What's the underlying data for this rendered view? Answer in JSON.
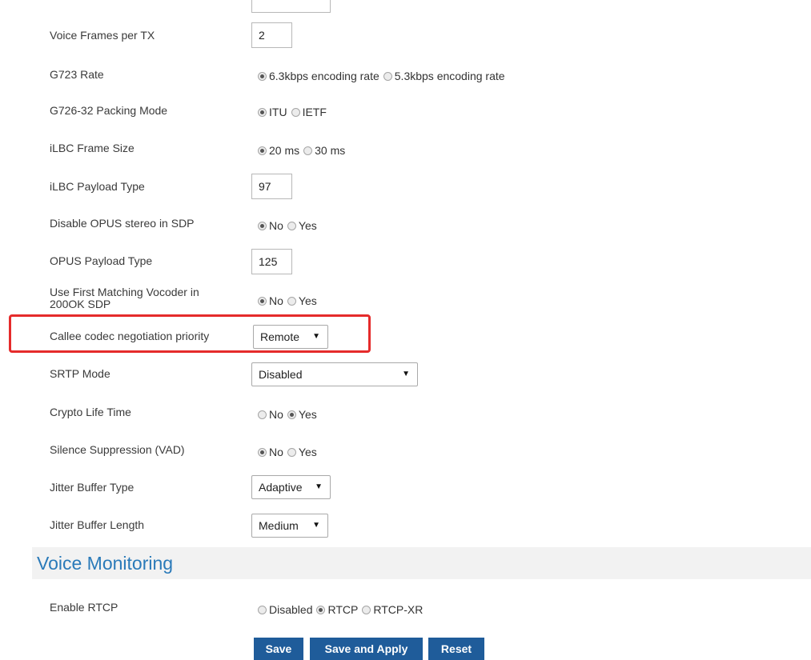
{
  "top_input": {
    "value": ""
  },
  "rows": {
    "voice_frames": {
      "label": "Voice Frames per TX",
      "value": "2"
    },
    "g723_rate": {
      "label": "G723 Rate",
      "options": [
        "6.3kbps encoding rate",
        "5.3kbps encoding rate"
      ],
      "selected": "6.3kbps encoding rate"
    },
    "g726_packing": {
      "label": "G726-32 Packing Mode",
      "options": [
        "ITU",
        "IETF"
      ],
      "selected": "ITU"
    },
    "ilbc_frame": {
      "label": "iLBC Frame Size",
      "options": [
        "20 ms",
        "30 ms"
      ],
      "selected": "20 ms"
    },
    "ilbc_payload": {
      "label": "iLBC Payload Type",
      "value": "97"
    },
    "disable_opus_stereo": {
      "label": "Disable OPUS stereo in SDP",
      "options": [
        "No",
        "Yes"
      ],
      "selected": "No"
    },
    "opus_payload": {
      "label": "OPUS Payload Type",
      "value": "125"
    },
    "first_matching_vocoder": {
      "label_line1": "Use First Matching Vocoder in",
      "label_line2": "200OK SDP",
      "options": [
        "No",
        "Yes"
      ],
      "selected": "No"
    },
    "callee_priority": {
      "label": "Callee codec negotiation priority",
      "value": "Remote"
    },
    "srtp_mode": {
      "label": "SRTP Mode",
      "value": "Disabled"
    },
    "crypto_life": {
      "label": "Crypto Life Time",
      "options": [
        "No",
        "Yes"
      ],
      "selected": "Yes"
    },
    "silence_suppression": {
      "label": "Silence Suppression (VAD)",
      "options": [
        "No",
        "Yes"
      ],
      "selected": "No"
    },
    "jitter_type": {
      "label": "Jitter Buffer Type",
      "value": "Adaptive"
    },
    "jitter_length": {
      "label": "Jitter Buffer Length",
      "value": "Medium"
    }
  },
  "section": {
    "title": "Voice Monitoring"
  },
  "enable_rtcp": {
    "label": "Enable RTCP",
    "options": [
      "Disabled",
      "RTCP",
      "RTCP-XR"
    ],
    "selected": "RTCP"
  },
  "buttons": {
    "save": "Save",
    "save_apply": "Save and Apply",
    "reset": "Reset"
  },
  "colors": {
    "accent": "#2a7ab9",
    "button_bg": "#1f5c9a",
    "highlight": "#e52b2b",
    "section_bg": "#f2f2f2"
  }
}
